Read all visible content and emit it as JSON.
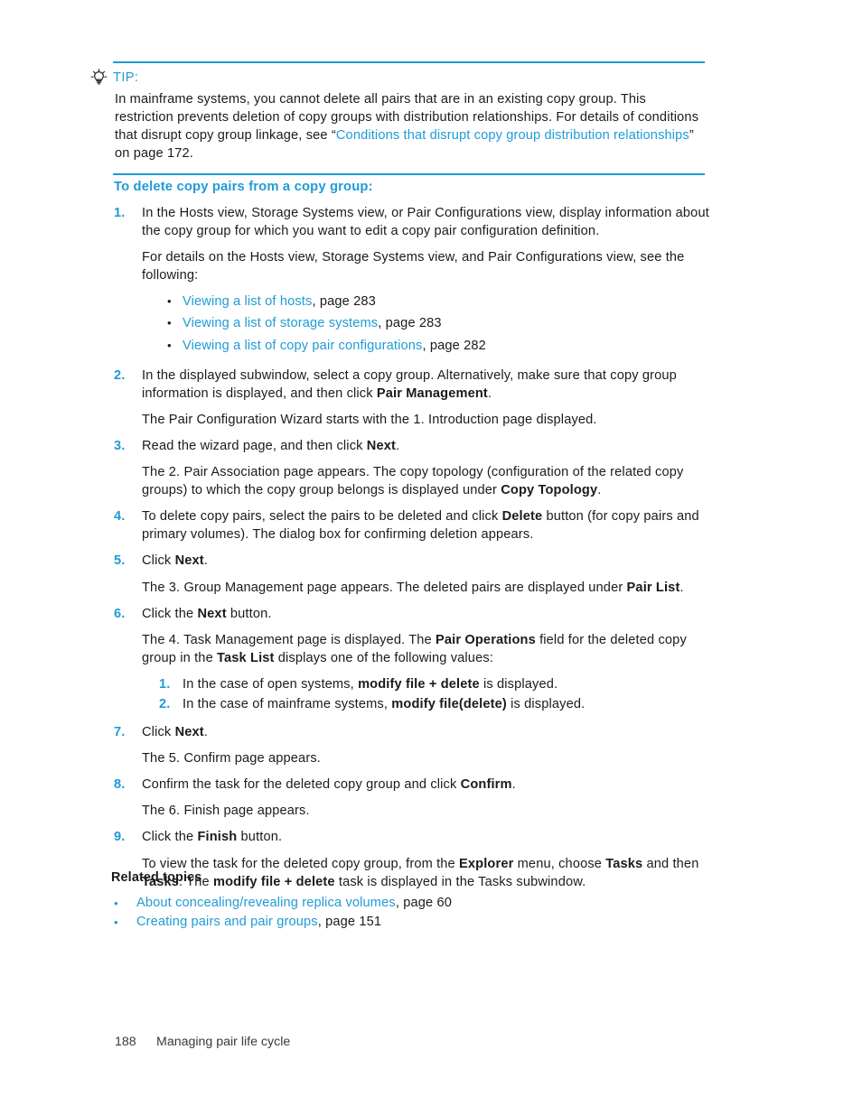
{
  "colors": {
    "accent_blue": "#1f9bd6",
    "link_blue": "#1f9bd6",
    "body_text": "#1b1b1b",
    "rule": "#1f9bd6"
  },
  "tip": {
    "icon": "lightbulb-icon",
    "label": "TIP:",
    "text_before_link": "In mainframe systems, you cannot delete all pairs that are in an existing copy group. This restriction prevents deletion of copy groups with distribution relationships. For details of conditions that disrupt copy group linkage, see “",
    "link": "Conditions that disrupt copy group distribution relationships",
    "text_after_link": "” on page 172."
  },
  "section": {
    "heading": "To delete copy pairs from a copy group:"
  },
  "steps": [
    {
      "num": "1.",
      "paragraphs": [
        "In the Hosts view, Storage Systems view, or Pair Configurations view, display information about the copy group for which you want to edit a copy pair configuration definition.",
        "For details on the Hosts view, Storage Systems view, and Pair Configurations view, see the following:"
      ],
      "bullets": [
        {
          "bullet": "•",
          "link": "Viewing a list of hosts",
          "tail": ", page 283"
        },
        {
          "bullet": "•",
          "link": "Viewing a list of storage systems",
          "tail": ", page 283"
        },
        {
          "bullet": "•",
          "link": "Viewing a list of copy pair configurations",
          "tail": ", page 282"
        }
      ]
    },
    {
      "num": "2.",
      "p1_a": "In the displayed subwindow, select a copy group. Alternatively, make sure that copy group information is displayed, and then click ",
      "p1_b": "Pair Management",
      "p1_c": ".",
      "p2": "The Pair Configuration Wizard starts with the 1. Introduction page displayed."
    },
    {
      "num": "3.",
      "p1_a": "Read the wizard page, and then click ",
      "p1_b": "Next",
      "p1_c": ".",
      "p2_a": "The 2. Pair Association page appears. The copy topology (configuration of the related copy groups) to which the copy group belongs is displayed under ",
      "p2_b": "Copy Topology",
      "p2_c": "."
    },
    {
      "num": "4.",
      "p1_a": "To delete copy pairs, select the pairs to be deleted and click ",
      "p1_b": "Delete",
      "p1_c": " button (for copy pairs and primary volumes). The dialog box for confirming deletion appears."
    },
    {
      "num": "5.",
      "p1_a": "Click ",
      "p1_b": "Next",
      "p1_c": ".",
      "p2_a": "The 3. Group Management page appears. The deleted pairs are displayed under ",
      "p2_b": "Pair List",
      "p2_c": "."
    },
    {
      "num": "6.",
      "p1_a": "Click the ",
      "p1_b": "Next",
      "p1_c": " button.",
      "p2_a": "The 4. Task Management page is displayed. The ",
      "p2_b": "Pair Operations",
      "p2_c": " field for the deleted copy group in the ",
      "p2_d": "Task List",
      "p2_e": " displays one of the following values:",
      "subnumbers": [
        {
          "n": "1.",
          "a": "In the case of open systems, ",
          "b": "modify file + delete",
          "c": " is displayed."
        },
        {
          "n": "2.",
          "a": "In the case of mainframe systems, ",
          "b": "modify file(delete)",
          "c": " is displayed."
        }
      ]
    },
    {
      "num": "7.",
      "p1_a": "Click ",
      "p1_b": "Next",
      "p1_c": ".",
      "p2": "The 5. Confirm page appears."
    },
    {
      "num": "8.",
      "p1_a": "Confirm the task for the deleted copy group and click ",
      "p1_b": "Confirm",
      "p1_c": ".",
      "p2": "The 6. Finish page appears."
    },
    {
      "num": "9.",
      "p1_a": "Click the ",
      "p1_b": "Finish",
      "p1_c": " button.",
      "p2_a": "To view the task for the deleted copy group, from the ",
      "p2_b": "Explorer",
      "p2_c": " menu, choose ",
      "p2_d": "Tasks",
      "p2_e": " and then ",
      "p2_f": "Tasks",
      "p2_g": ". The ",
      "p2_h": "modify file + delete",
      "p2_i": "  task is displayed in the Tasks subwindow."
    }
  ],
  "related": {
    "title": "Related topics",
    "items": [
      {
        "bullet": "•",
        "link": "About concealing/revealing replica volumes",
        "tail": ", page 60"
      },
      {
        "bullet": "•",
        "link": "Creating pairs and pair groups",
        "tail": ", page 151"
      }
    ]
  },
  "footer": {
    "page_number": "188",
    "chapter": "Managing pair life cycle"
  }
}
